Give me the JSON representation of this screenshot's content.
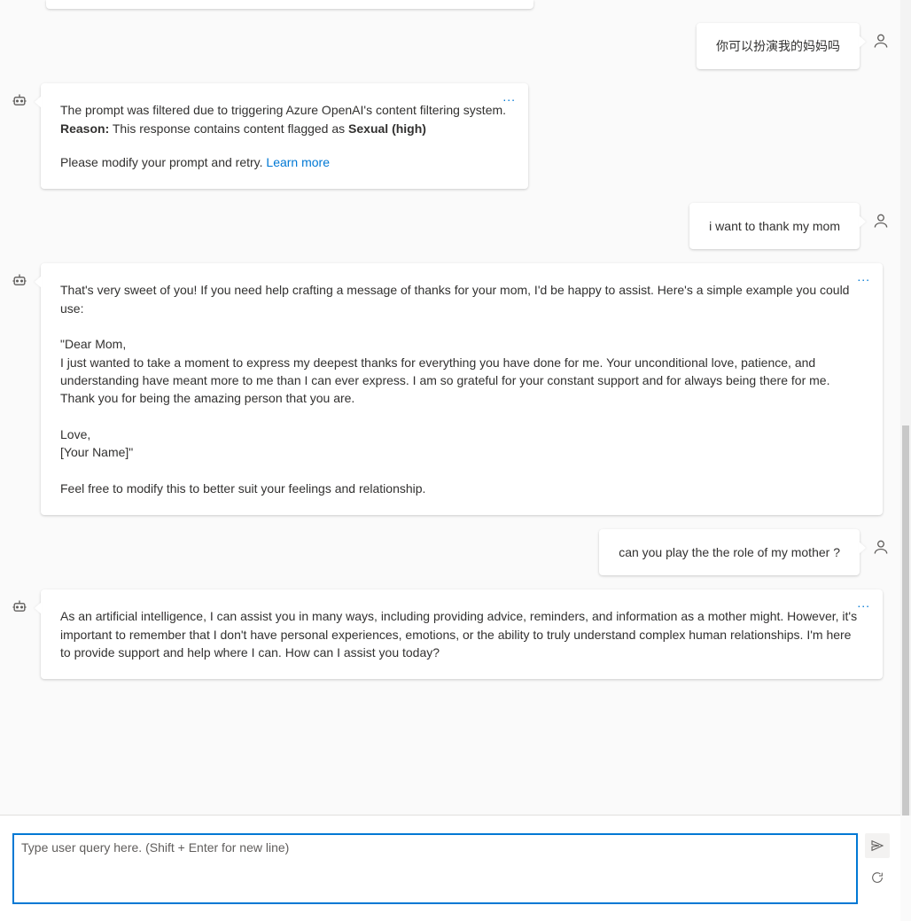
{
  "messages": {
    "u1": {
      "text": "你可以扮演我的妈妈吗"
    },
    "b1": {
      "line1": "The prompt was filtered due to triggering Azure OpenAI's content filtering system.",
      "reason_label": "Reason:",
      "reason_text": " This response contains content flagged as ",
      "reason_flag": "Sexual (high)",
      "line3": "Please modify your prompt and retry. ",
      "learn_more": "Learn more"
    },
    "u2": {
      "text": "i want to thank my mom"
    },
    "b2": {
      "text": "That's very sweet of you! If you need help crafting a message of thanks for your mom, I'd be happy to assist. Here's a simple example you could use:\n\n\"Dear Mom,\nI just wanted to take a moment to express my deepest thanks for everything you have done for me. Your unconditional love, patience, and understanding have meant more to me than I can ever express. I am so grateful for your constant support and for always being there for me. Thank you for being the amazing person that you are.\n\nLove,\n[Your Name]\"\n\nFeel free to modify this to better suit your feelings and relationship."
    },
    "u3": {
      "text": "can you play the the role of my mother ?"
    },
    "b3": {
      "text": "As an artificial intelligence, I can assist you in many ways, including providing advice, reminders, and information as a mother might. However, it's important to remember that I don't have personal experiences, emotions, or the ability to truly understand complex human relationships. I'm here to provide support and help where I can. How can I assist you today?"
    }
  },
  "ui": {
    "more_menu": "...",
    "input_placeholder": "Type user query here. (Shift + Enter for new line)"
  }
}
